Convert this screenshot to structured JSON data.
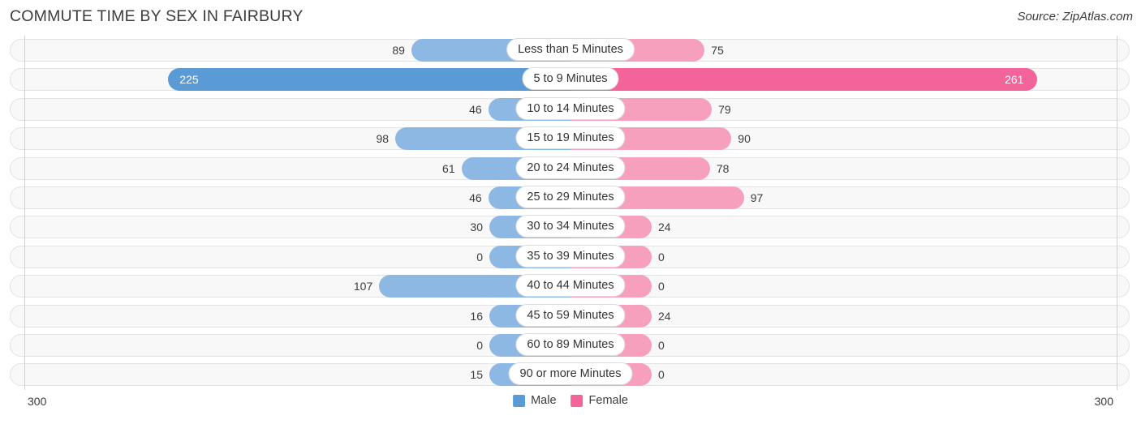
{
  "header": {
    "title": "COMMUTE TIME BY SEX IN FAIRBURY",
    "source": "Source: ZipAtlas.com"
  },
  "legend": {
    "male_label": "Male",
    "female_label": "Female",
    "male_color": "#5b9bd5",
    "female_color": "#f2649a",
    "male_color_light": "#8db8e3",
    "female_color_light": "#f7a0bd"
  },
  "axis": {
    "left_label": "300",
    "right_label": "300",
    "max": 300
  },
  "chart_data": {
    "type": "bar",
    "title": "COMMUTE TIME BY SEX IN FAIRBURY",
    "subtitle": "Source: ZipAtlas.com",
    "orientation": "horizontal-diverging",
    "xlabel": "",
    "ylabel": "",
    "xlim": [
      300,
      300
    ],
    "grid": false,
    "legend_position": "bottom-center",
    "categories": [
      "Less than 5 Minutes",
      "5 to 9 Minutes",
      "10 to 14 Minutes",
      "15 to 19 Minutes",
      "20 to 24 Minutes",
      "25 to 29 Minutes",
      "30 to 34 Minutes",
      "35 to 39 Minutes",
      "40 to 44 Minutes",
      "45 to 59 Minutes",
      "60 to 89 Minutes",
      "90 or more Minutes"
    ],
    "series": [
      {
        "name": "Male",
        "color": "#5b9bd5",
        "values": [
          89,
          225,
          46,
          98,
          61,
          46,
          30,
          0,
          107,
          16,
          0,
          15
        ]
      },
      {
        "name": "Female",
        "color": "#f2649a",
        "values": [
          75,
          261,
          79,
          90,
          78,
          97,
          24,
          0,
          0,
          24,
          0,
          0
        ]
      }
    ],
    "rows": [
      {
        "category": "Less than 5 Minutes",
        "male": 89,
        "female": 75,
        "male_text": "89",
        "female_text": "75",
        "peak": false
      },
      {
        "category": "5 to 9 Minutes",
        "male": 225,
        "female": 261,
        "male_text": "225",
        "female_text": "261",
        "peak": true
      },
      {
        "category": "10 to 14 Minutes",
        "male": 46,
        "female": 79,
        "male_text": "46",
        "female_text": "79",
        "peak": false
      },
      {
        "category": "15 to 19 Minutes",
        "male": 98,
        "female": 90,
        "male_text": "98",
        "female_text": "90",
        "peak": false
      },
      {
        "category": "20 to 24 Minutes",
        "male": 61,
        "female": 78,
        "male_text": "61",
        "female_text": "78",
        "peak": false
      },
      {
        "category": "25 to 29 Minutes",
        "male": 46,
        "female": 97,
        "male_text": "46",
        "female_text": "97",
        "peak": false
      },
      {
        "category": "30 to 34 Minutes",
        "male": 30,
        "female": 24,
        "male_text": "30",
        "female_text": "24",
        "peak": false
      },
      {
        "category": "35 to 39 Minutes",
        "male": 0,
        "female": 0,
        "male_text": "0",
        "female_text": "0",
        "peak": false
      },
      {
        "category": "40 to 44 Minutes",
        "male": 107,
        "female": 0,
        "male_text": "107",
        "female_text": "0",
        "peak": false
      },
      {
        "category": "45 to 59 Minutes",
        "male": 16,
        "female": 24,
        "male_text": "16",
        "female_text": "24",
        "peak": false
      },
      {
        "category": "60 to 89 Minutes",
        "male": 0,
        "female": 0,
        "male_text": "0",
        "female_text": "0",
        "peak": false
      },
      {
        "category": "90 or more Minutes",
        "male": 15,
        "female": 0,
        "male_text": "15",
        "female_text": "0",
        "peak": false
      }
    ]
  }
}
